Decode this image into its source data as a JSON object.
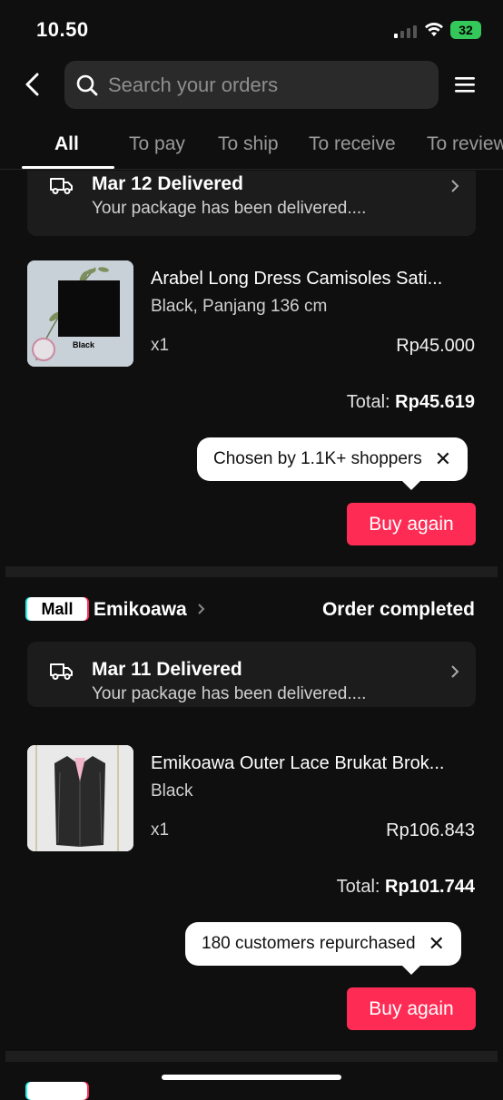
{
  "status_bar": {
    "time": "10.50",
    "battery": "32"
  },
  "header": {
    "search_placeholder": "Search your orders"
  },
  "tabs": [
    {
      "label": "All"
    },
    {
      "label": "To pay"
    },
    {
      "label": "To ship"
    },
    {
      "label": "To receive"
    },
    {
      "label": "To review"
    }
  ],
  "orders": [
    {
      "delivery_title": "Mar 12 Delivered",
      "delivery_sub": "Your package has been delivered....",
      "product_name": "Arabel Long Dress Camisoles Sati...",
      "variant": "Black, Panjang 136 cm",
      "image_label": "Black",
      "qty": "x1",
      "price": "Rp45.000",
      "total_label": "Total: ",
      "total_value": "Rp45.619",
      "tooltip": "Chosen by 1.1K+ shoppers",
      "buy_again": "Buy again"
    },
    {
      "badge": "Mall",
      "store": "Emikoawa",
      "status": "Order completed",
      "delivery_title": "Mar 11 Delivered",
      "delivery_sub": "Your package has been delivered....",
      "product_name": "Emikoawa Outer Lace Brukat Brok...",
      "variant": "Black",
      "qty": "x1",
      "price": "Rp106.843",
      "total_label": "Total: ",
      "total_value": "Rp101.744",
      "tooltip": "180 customers repurchased",
      "buy_again": "Buy again"
    }
  ],
  "colors": {
    "accent": "#fe2c55",
    "background": "#0f0f0f",
    "card": "#1c1c1c"
  }
}
